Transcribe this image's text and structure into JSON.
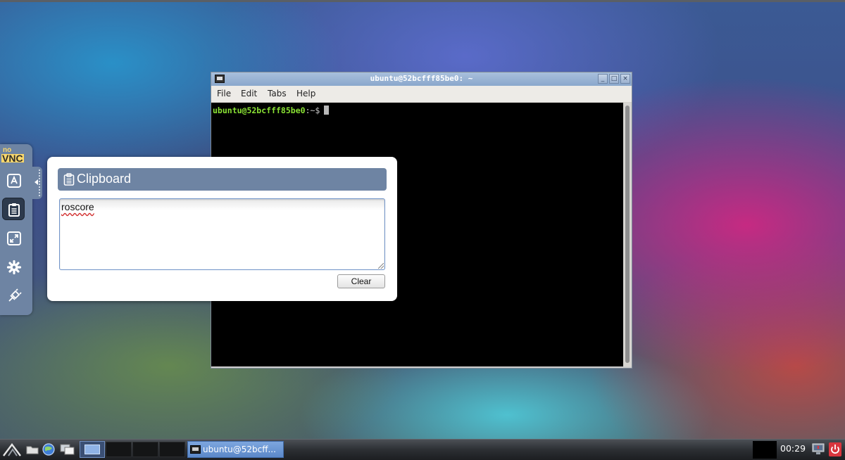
{
  "terminal": {
    "title": "ubuntu@52bcfff85be0: ~",
    "menu": [
      "File",
      "Edit",
      "Tabs",
      "Help"
    ],
    "prompt_user": "ubuntu@52bcfff85be0",
    "prompt_path": ":~$",
    "window_buttons": {
      "minimize": "_",
      "maximize": "□",
      "close": "×"
    }
  },
  "novnc": {
    "logo_no": "no",
    "logo_vnc": "VNC",
    "buttons": [
      {
        "name": "extra-keys",
        "icon": "keyboard-a-icon"
      },
      {
        "name": "clipboard",
        "icon": "clipboard-icon",
        "active": true
      },
      {
        "name": "fullscreen",
        "icon": "fullscreen-icon"
      },
      {
        "name": "settings",
        "icon": "gear-icon"
      },
      {
        "name": "disconnect",
        "icon": "disconnect-plug-icon"
      }
    ]
  },
  "clipboard": {
    "title": "Clipboard",
    "text": "roscore",
    "clear_label": "Clear"
  },
  "taskbar": {
    "task_label": "ubuntu@52bcff...",
    "clock": "00:29"
  },
  "colors": {
    "novnc_panel": "#6e84a3",
    "prompt_green": "#8ae234",
    "task_active": "#5b88c9",
    "logout_red": "#d9363e"
  }
}
